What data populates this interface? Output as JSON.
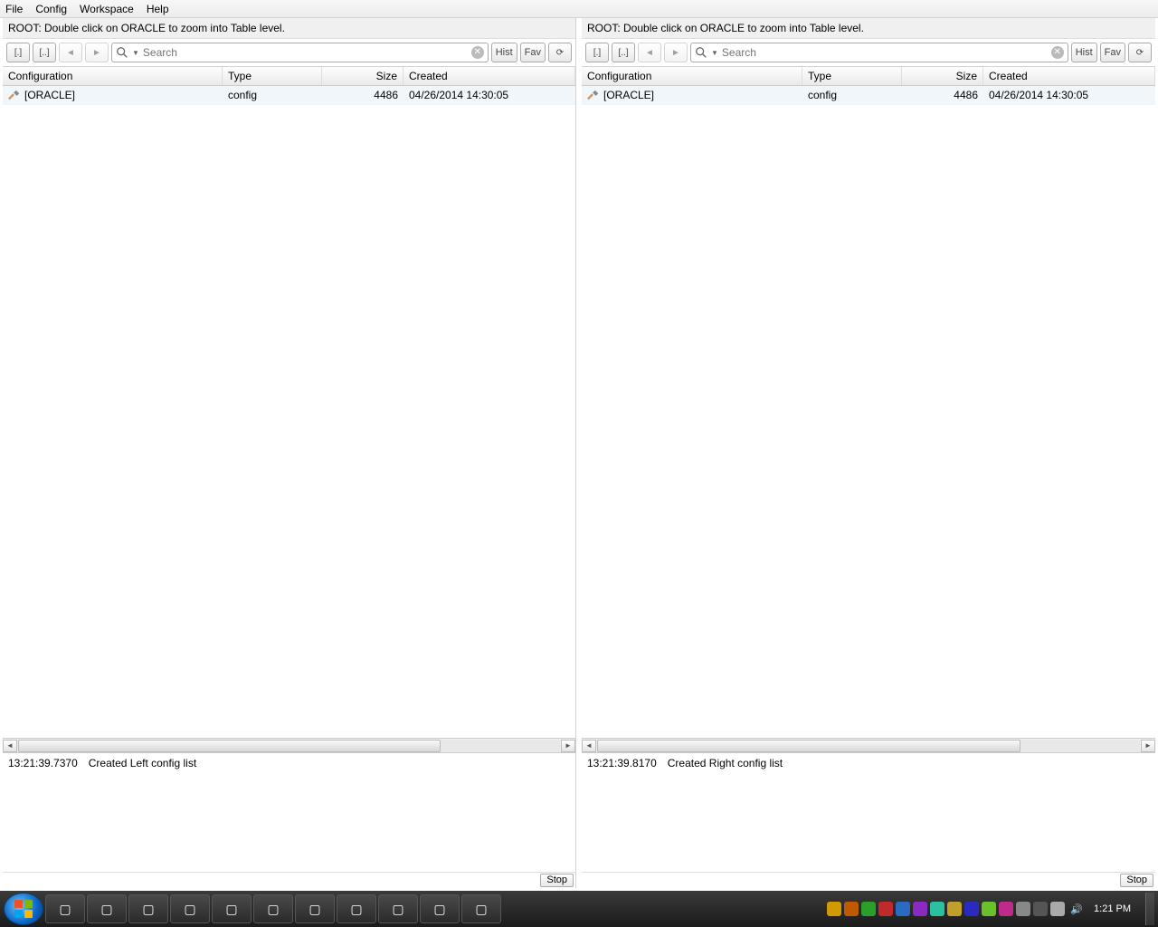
{
  "menu": {
    "file": "File",
    "config": "Config",
    "workspace": "Workspace",
    "help": "Help"
  },
  "panes": {
    "left": {
      "hint": "ROOT: Double click on ORACLE to zoom into Table level.",
      "toolbar": {
        "rootBtn": "[.]",
        "upBtn": "[..]",
        "histBtn": "Hist",
        "favBtn": "Fav",
        "searchPlaceholder": "Search"
      },
      "columns": {
        "configuration": "Configuration",
        "type": "Type",
        "size": "Size",
        "created": "Created"
      },
      "rows": [
        {
          "name": "[ORACLE]",
          "type": "config",
          "size": "4486",
          "created": "04/26/2014 14:30:05"
        }
      ],
      "log": {
        "time": "13:21:39.7370",
        "msg": "Created Left config list",
        "stop": "Stop"
      }
    },
    "right": {
      "hint": "ROOT: Double click on ORACLE to zoom into Table level.",
      "toolbar": {
        "rootBtn": "[.]",
        "upBtn": "[..]",
        "histBtn": "Hist",
        "favBtn": "Fav",
        "searchPlaceholder": "Search"
      },
      "columns": {
        "configuration": "Configuration",
        "type": "Type",
        "size": "Size",
        "created": "Created"
      },
      "rows": [
        {
          "name": "[ORACLE]",
          "type": "config",
          "size": "4486",
          "created": "04/26/2014 14:30:05"
        }
      ],
      "log": {
        "time": "13:21:39.8170",
        "msg": "Created Right config list",
        "stop": "Stop"
      }
    }
  },
  "taskbar": {
    "clock": "1:21 PM",
    "apps": [
      "ie",
      "explorer",
      "media",
      "tool1",
      "tool2",
      "word",
      "app1",
      "app2",
      "paint",
      "cmd",
      "term"
    ],
    "tray": [
      {
        "bg": "#d19a00"
      },
      {
        "bg": "#c05a00"
      },
      {
        "bg": "#2aa02a"
      },
      {
        "bg": "#c02a2a"
      },
      {
        "bg": "#2a6ac0"
      },
      {
        "bg": "#8a2ac0"
      },
      {
        "bg": "#2ac0a0"
      },
      {
        "bg": "#c0a02a"
      },
      {
        "bg": "#2a2ac0"
      },
      {
        "bg": "#6ac02a"
      },
      {
        "bg": "#c02a8a"
      },
      {
        "bg": "#888"
      },
      {
        "bg": "#555"
      },
      {
        "bg": "#aaa"
      }
    ]
  }
}
